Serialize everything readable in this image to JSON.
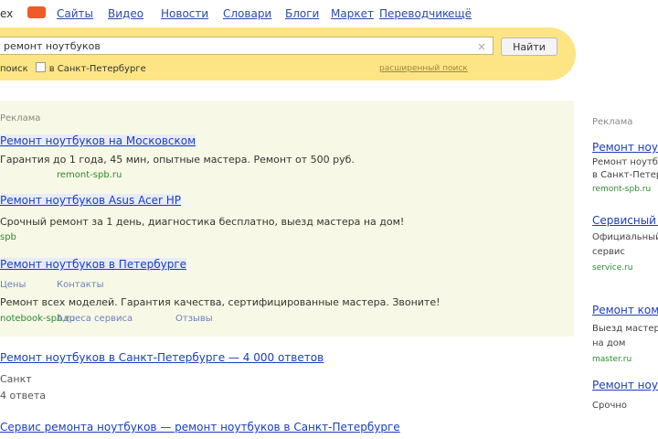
{
  "topnav": {
    "logo_text": "ex",
    "items": [
      "Сайты",
      "Видео",
      "Новости",
      "Словари",
      "Блоги",
      "Маркет",
      "Переводчик",
      "ещё"
    ]
  },
  "search": {
    "query": "ремонт ноутбуков",
    "button_label": "Найти",
    "region_prefix": "поиск",
    "region_checkbox_label": "в Санкт-Петербурге",
    "advanced_link": "расширенный поиск"
  },
  "ads": {
    "label": "Реклама",
    "items": [
      {
        "title": "Ремонт ноутбуков на Московском",
        "text": "Гарантия до 1 года, 45 мин, опытные мастера. Ремонт от 500 руб.",
        "url": "remont-spb.ru",
        "sublinks": []
      },
      {
        "title": "Ремонт ноутбуков Asus Acer HP",
        "text": "Срочный ремонт за 1 день, диагностика бесплатно, выезд мастера на дом!",
        "url": "spb",
        "sublinks": []
      },
      {
        "title": "Ремонт ноутбуков в Петербурге",
        "text": "Ремонт всех моделей. Гарантия качества, сертифицированные мастера. Звоните!",
        "url": "notebook-spb.ru",
        "sublinks": [
          "Цены",
          "Контакты",
          "Адреса сервиса",
          "Отзывы"
        ]
      }
    ]
  },
  "results": [
    {
      "title": "Ремонт ноутбуков в Санкт-Петербурге — 4 000 ответов",
      "lines": [
        "Санкт",
        "4 ответа"
      ]
    },
    {
      "title": "Сервис ремонта ноутбуков — ремонт ноутбуков в Санкт-Петербурге",
      "lines": []
    }
  ],
  "sidebar": {
    "header": "Реклама",
    "items": [
      {
        "title": "Ремонт ноутбуков",
        "text": [
          "Ремонт ноутбуков",
          "в Санкт-Петербурге"
        ],
        "url": "remont-spb.ru"
      },
      {
        "title": "Сервисный центр",
        "text": [
          "Официальный",
          "сервис"
        ],
        "url": "service.ru"
      },
      {
        "title": "Ремонт компьютеров",
        "text": [
          "Выезд мастера",
          "на дом"
        ],
        "url": "master.ru"
      },
      {
        "title": "Ремонт ноутбуков",
        "text": [
          "Срочно"
        ],
        "url": ""
      }
    ]
  }
}
